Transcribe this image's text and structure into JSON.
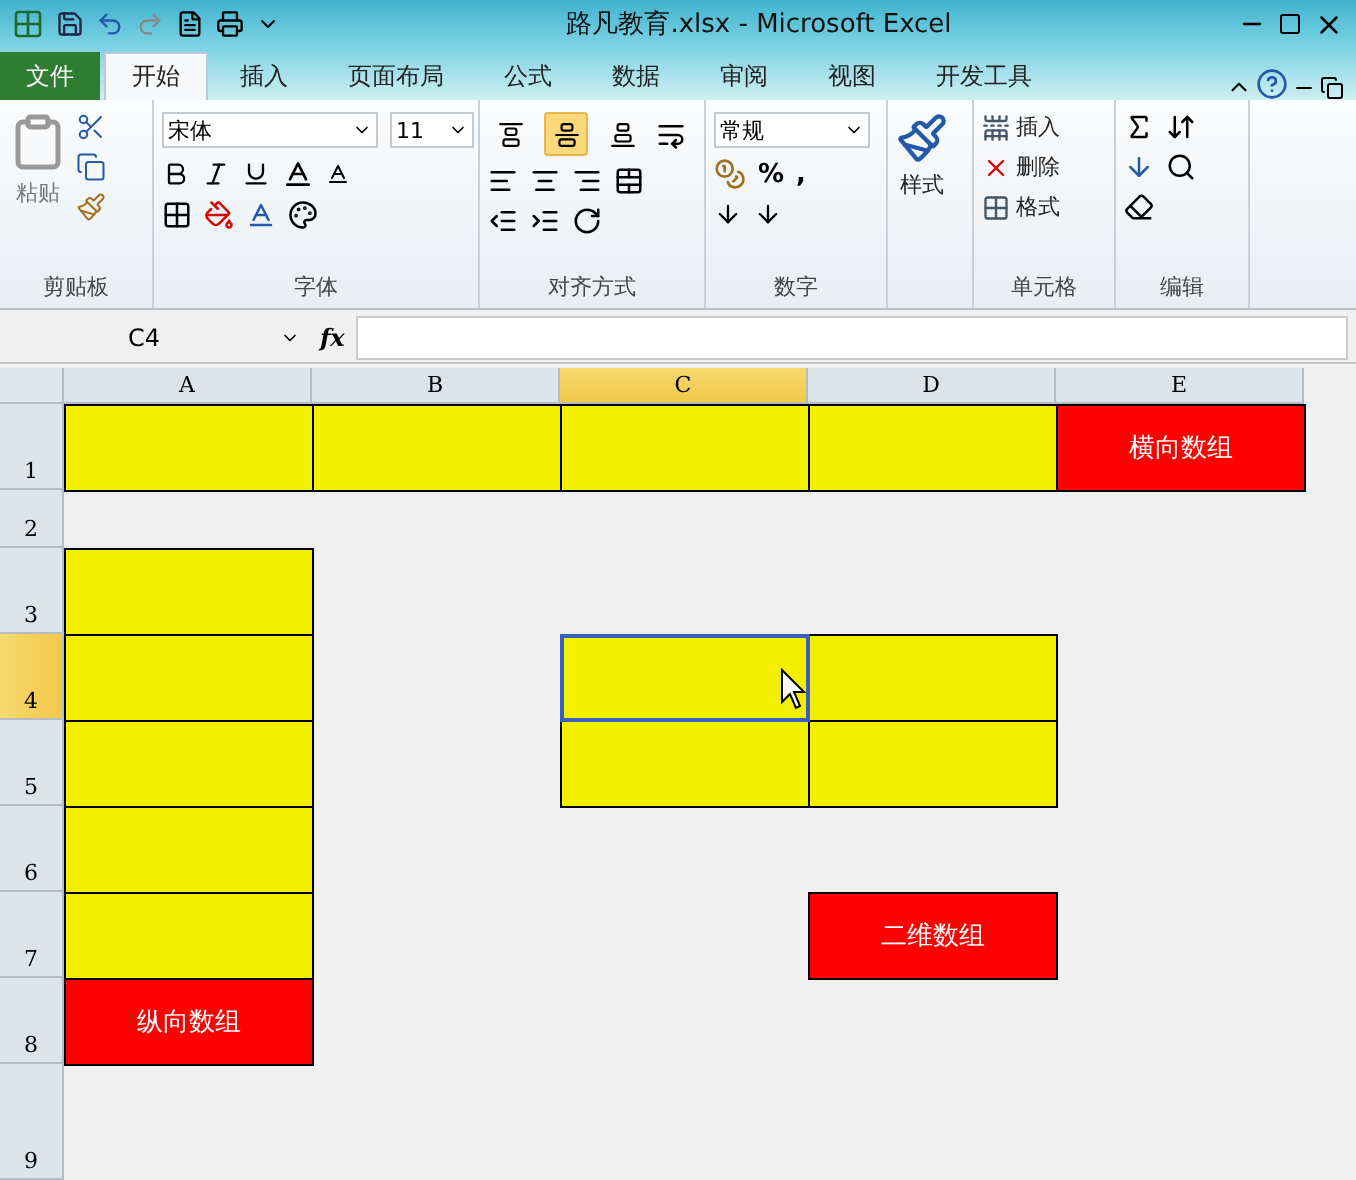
{
  "window": {
    "title": "路凡教育.xlsx - Microsoft Excel"
  },
  "file_tab": "文件",
  "tabs": [
    {
      "label": "开始",
      "selected": true
    },
    {
      "label": "插入",
      "selected": false
    },
    {
      "label": "页面布局",
      "selected": false
    },
    {
      "label": "公式",
      "selected": false
    },
    {
      "label": "数据",
      "selected": false
    },
    {
      "label": "审阅",
      "selected": false
    },
    {
      "label": "视图",
      "selected": false
    },
    {
      "label": "开发工具",
      "selected": false
    }
  ],
  "ribbon": {
    "clipboard": {
      "label": "剪贴板",
      "paste": "粘贴"
    },
    "font": {
      "label": "字体",
      "font_name": "宋体",
      "font_size": "11"
    },
    "alignment": {
      "label": "对齐方式",
      "vertical": [
        {
          "kind": "top",
          "selected": false
        },
        {
          "kind": "middle",
          "selected": true
        },
        {
          "kind": "bottom",
          "selected": false
        }
      ]
    },
    "number": {
      "label": "数字",
      "format": "常规",
      "percent": "%",
      "comma": ","
    },
    "styles": {
      "label": "样式"
    },
    "cells": {
      "label": "单元格",
      "buttons": [
        {
          "kind": "insert",
          "label": "插入"
        },
        {
          "kind": "delete",
          "label": "删除"
        },
        {
          "kind": "format",
          "label": "格式"
        }
      ]
    },
    "editing": {
      "label": "编辑"
    }
  },
  "formula_bar": {
    "name_box": "C4",
    "fx": "fx"
  },
  "columns": [
    {
      "label": "A",
      "selected": false
    },
    {
      "label": "B",
      "selected": false
    },
    {
      "label": "C",
      "selected": true
    },
    {
      "label": "D",
      "selected": false
    },
    {
      "label": "E",
      "selected": false
    }
  ],
  "rows": [
    {
      "label": "1",
      "selected": false,
      "cells": [
        {
          "color": "#f2f000",
          "selected": false
        },
        {
          "color": "#f2f000",
          "selected": false
        },
        {
          "color": "#f2f000",
          "selected": false
        },
        {
          "color": "#f2f000",
          "selected": false
        },
        {
          "color": "#ff0000",
          "text": "横向数组",
          "selected": false
        }
      ]
    },
    {
      "label": "2",
      "selected": false,
      "cells": [
        {
          "selected": false
        },
        {
          "selected": false
        },
        {
          "selected": false
        },
        {
          "selected": false
        },
        {
          "selected": false
        }
      ]
    },
    {
      "label": "3",
      "selected": false,
      "cells": [
        {
          "color": "#f2f000",
          "selected": false
        },
        {
          "selected": false
        },
        {
          "selected": false
        },
        {
          "selected": false
        },
        {
          "selected": false
        }
      ]
    },
    {
      "label": "4",
      "selected": true,
      "cells": [
        {
          "color": "#f2f000",
          "selected": false
        },
        {
          "selected": false
        },
        {
          "color": "#f2f000",
          "selected": true
        },
        {
          "color": "#f2f000",
          "selected": false
        },
        {
          "selected": false
        }
      ]
    },
    {
      "label": "5",
      "selected": false,
      "cells": [
        {
          "color": "#f2f000",
          "selected": false
        },
        {
          "selected": false
        },
        {
          "color": "#f2f000",
          "selected": false
        },
        {
          "color": "#f2f000",
          "selected": false
        },
        {
          "selected": false
        }
      ]
    },
    {
      "label": "6",
      "selected": false,
      "cells": [
        {
          "color": "#f2f000",
          "selected": false
        },
        {
          "selected": false
        },
        {
          "selected": false
        },
        {
          "selected": false
        },
        {
          "selected": false
        }
      ]
    },
    {
      "label": "7",
      "selected": false,
      "cells": [
        {
          "color": "#f2f000",
          "selected": false
        },
        {
          "selected": false
        },
        {
          "selected": false
        },
        {
          "color": "#ff0000",
          "text": "二维数组",
          "selected": false
        },
        {
          "selected": false
        }
      ]
    },
    {
      "label": "8",
      "selected": false,
      "cells": [
        {
          "color": "#ff0000",
          "text": "纵向数组",
          "selected": false
        },
        {
          "selected": false
        },
        {
          "selected": false
        },
        {
          "selected": false
        },
        {
          "selected": false
        }
      ]
    },
    {
      "label": "9",
      "selected": false,
      "cells": [
        {
          "selected": false
        },
        {
          "selected": false
        },
        {
          "selected": false
        },
        {
          "selected": false
        },
        {
          "selected": false
        }
      ]
    }
  ]
}
